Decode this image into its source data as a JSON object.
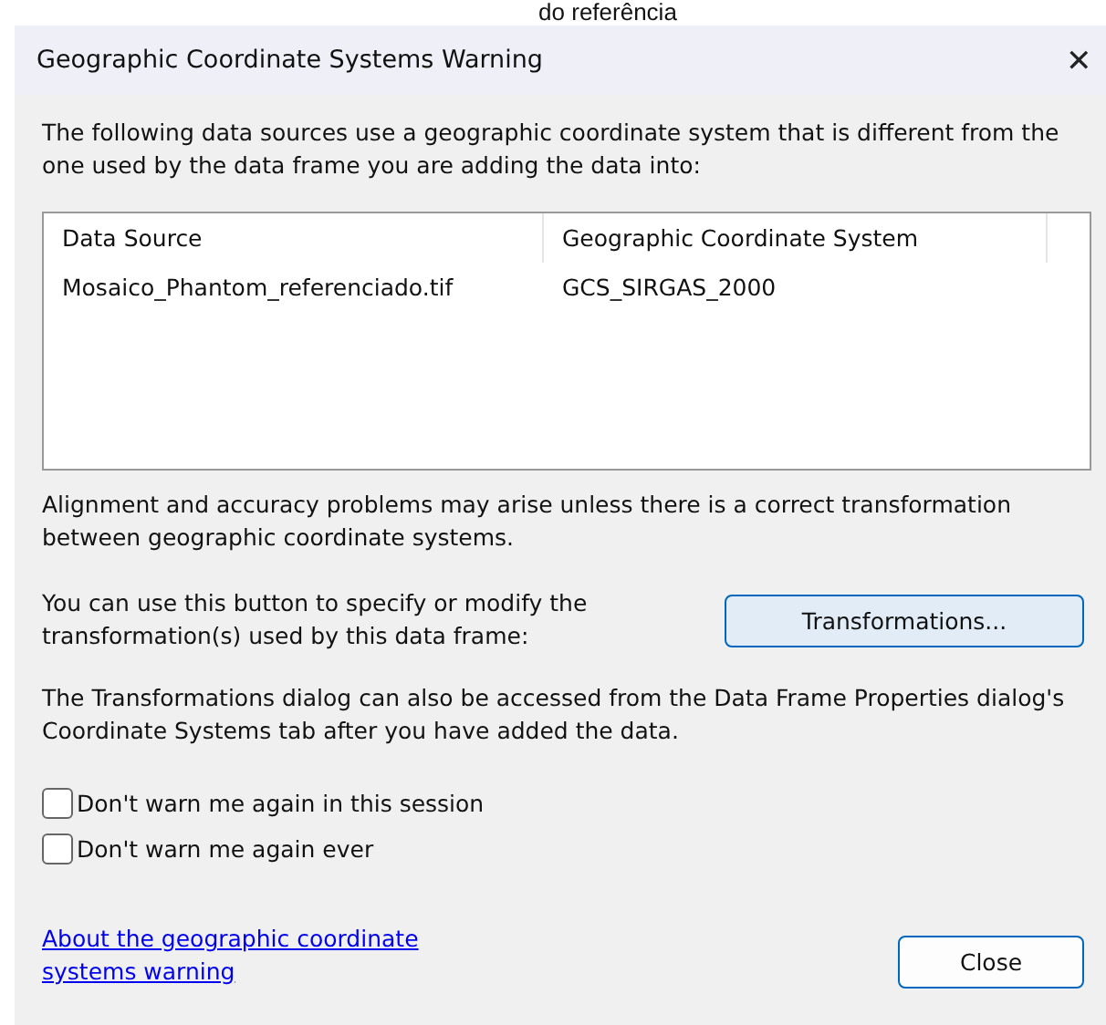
{
  "caption": "do referência",
  "window": {
    "title": "Geographic Coordinate Systems Warning",
    "close": "✕"
  },
  "intro": "The following data sources use a geographic coordinate system that is different from the one used by the data frame you are adding the data into:",
  "table": {
    "columns": [
      "Data Source",
      "Geographic Coordinate System"
    ],
    "rows": [
      [
        "Mosaico_Phantom_referenciado.tif",
        "GCS_SIRGAS_2000"
      ]
    ]
  },
  "alignment_note": "Alignment and accuracy problems may arise unless there is a correct transformation between geographic coordinate systems.",
  "transform_note": "You can use this button to specify or modify the transformation(s) used by this data frame:",
  "transform_button": "Transformations...",
  "dialog_note": "The Transformations dialog can also be accessed from the Data Frame Properties dialog's Coordinate Systems tab after you have added the data.",
  "checkboxes": [
    {
      "label": "Don't warn me again in this session",
      "checked": false
    },
    {
      "label": "Don't warn me again ever",
      "checked": false
    }
  ],
  "link": [
    "About the geographic coordinate",
    "systems warning"
  ],
  "close_button": "Close"
}
